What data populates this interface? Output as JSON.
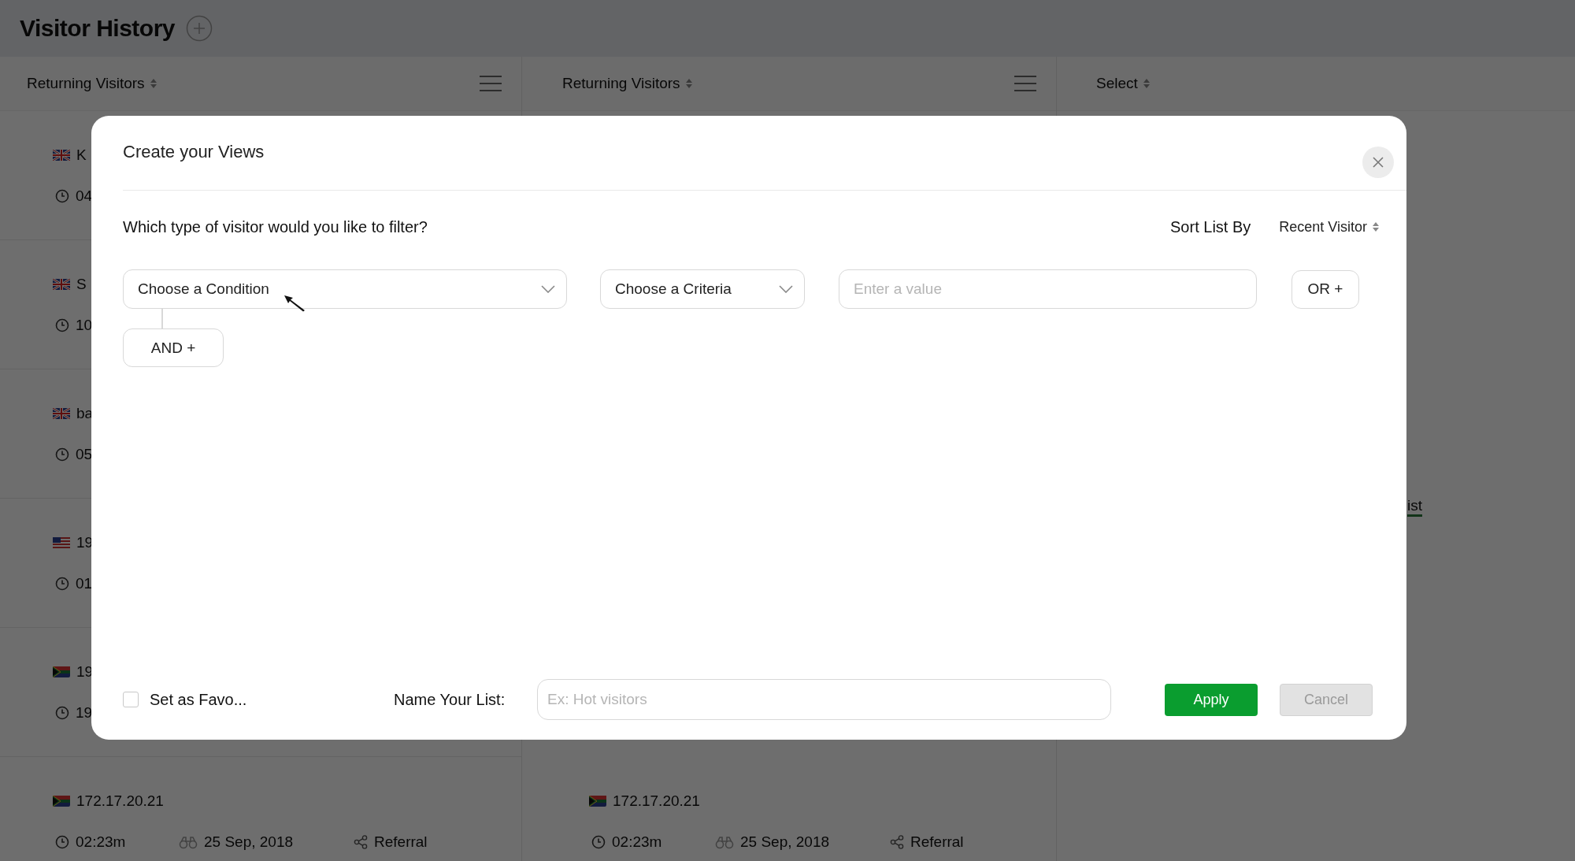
{
  "page": {
    "title": "Visitor History"
  },
  "columns": [
    {
      "header": "Returning Visitors",
      "menu": true,
      "rows": [
        {
          "kind": "uk",
          "label": "K",
          "time": "04"
        },
        {
          "kind": "uk",
          "label": "S",
          "time": "10"
        },
        {
          "kind": "uk",
          "label": "ba",
          "time": "05"
        },
        {
          "kind": "us",
          "label": "19",
          "time": "01"
        },
        {
          "kind": "za",
          "label": "19",
          "time": "19"
        },
        {
          "kind": "za",
          "label": "172.17.20.21",
          "time": "02:23m",
          "date": "25 Sep, 2018",
          "source": "Referral"
        }
      ]
    },
    {
      "header": "Returning Visitors",
      "menu": true,
      "rows": [
        {
          "kind": "za",
          "label": "172.17.20.21",
          "time": "02:23m",
          "date": "25 Sep, 2018",
          "source": "Referral"
        }
      ]
    },
    {
      "header": "Select",
      "menu": false,
      "fragment": "ist"
    }
  ],
  "dialog": {
    "title": "Create your Views",
    "question": "Which type of visitor would you like to filter?",
    "sort_label": "Sort List By",
    "sort_value": "Recent Visitor",
    "condition": "Choose a Condition",
    "criteria": "Choose a Criteria",
    "value_field": {
      "placeholder": "Enter a value"
    },
    "or_button": "OR +",
    "and_button": "AND +",
    "favorite": {
      "label": "Set as Favo...",
      "checked": false
    },
    "name_label": "Name Your List:",
    "name_field": {
      "placeholder": "Ex: Hot visitors"
    },
    "buttons": [
      {
        "label": "Apply",
        "kind": "primary"
      },
      {
        "label": "Cancel",
        "kind": "secondary"
      }
    ]
  }
}
